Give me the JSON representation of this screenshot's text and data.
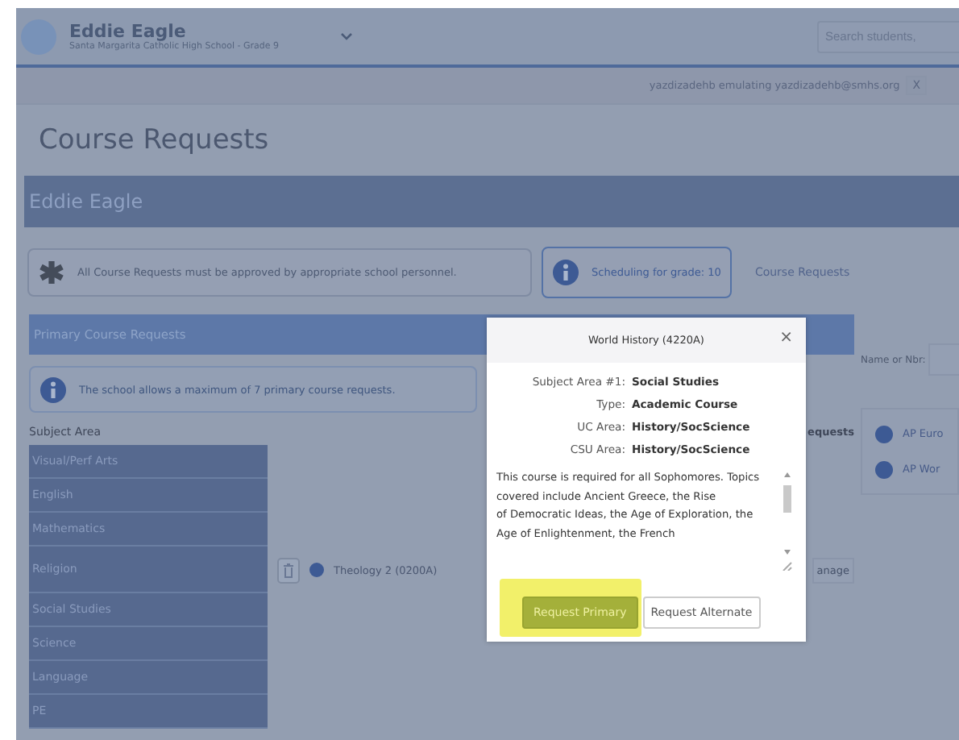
{
  "header": {
    "student_name": "Eddie Eagle",
    "school": "Santa Margarita Catholic High School - Grade 9",
    "search": {
      "placeholder": "Search students, "
    }
  },
  "emulation": {
    "text": "yazdizadehb emulating yazdizadehb@smhs.org",
    "close": "X"
  },
  "page_title": "Course Requests",
  "student_banner": "Eddie Eagle",
  "notices": [
    {
      "kind": "approval",
      "text": "All Course Requests must be approved by appropriate school personnel."
    },
    {
      "kind": "info",
      "text": "Scheduling for grade: 10"
    }
  ],
  "breadcrumb": "Course Requests",
  "primary": {
    "title": "Primary Course Requests",
    "info": "The school allows a maximum of 7 primary course requests.",
    "subject_heading": "Subject Area",
    "requests_heading": "equests",
    "subjects": [
      {
        "name": "Visual/Perf Arts"
      },
      {
        "name": "English"
      },
      {
        "name": "Mathematics"
      },
      {
        "name": "Religion",
        "course": "Theology 2 (0200A)",
        "action": "anage"
      },
      {
        "name": "Social Studies"
      },
      {
        "name": "Science"
      },
      {
        "name": "Language"
      },
      {
        "name": "PE"
      }
    ]
  },
  "search_panel": {
    "label": "Name or Nbr:",
    "results": [
      "AP Euro",
      "AP Wor"
    ]
  },
  "modal": {
    "title": "World History (4220A)",
    "close": "×",
    "rows": [
      {
        "label": "Subject Area #1:",
        "value": "Social Studies"
      },
      {
        "label": "Type:",
        "value": "Academic Course"
      },
      {
        "label": "UC Area:",
        "value": "History/SocScience"
      },
      {
        "label": "CSU Area:",
        "value": "History/SocScience"
      }
    ],
    "description": "This course is required for all Sophomores. Topics covered include Ancient Greece, the Rise\nof Democratic Ideas, the Age of Exploration, the Age of Enlightenment, the French",
    "buttons": [
      {
        "label": "Request Primary",
        "kind": "primary",
        "highlighted": true
      },
      {
        "label": "Request Alternate",
        "kind": "secondary",
        "highlighted": false
      }
    ]
  }
}
